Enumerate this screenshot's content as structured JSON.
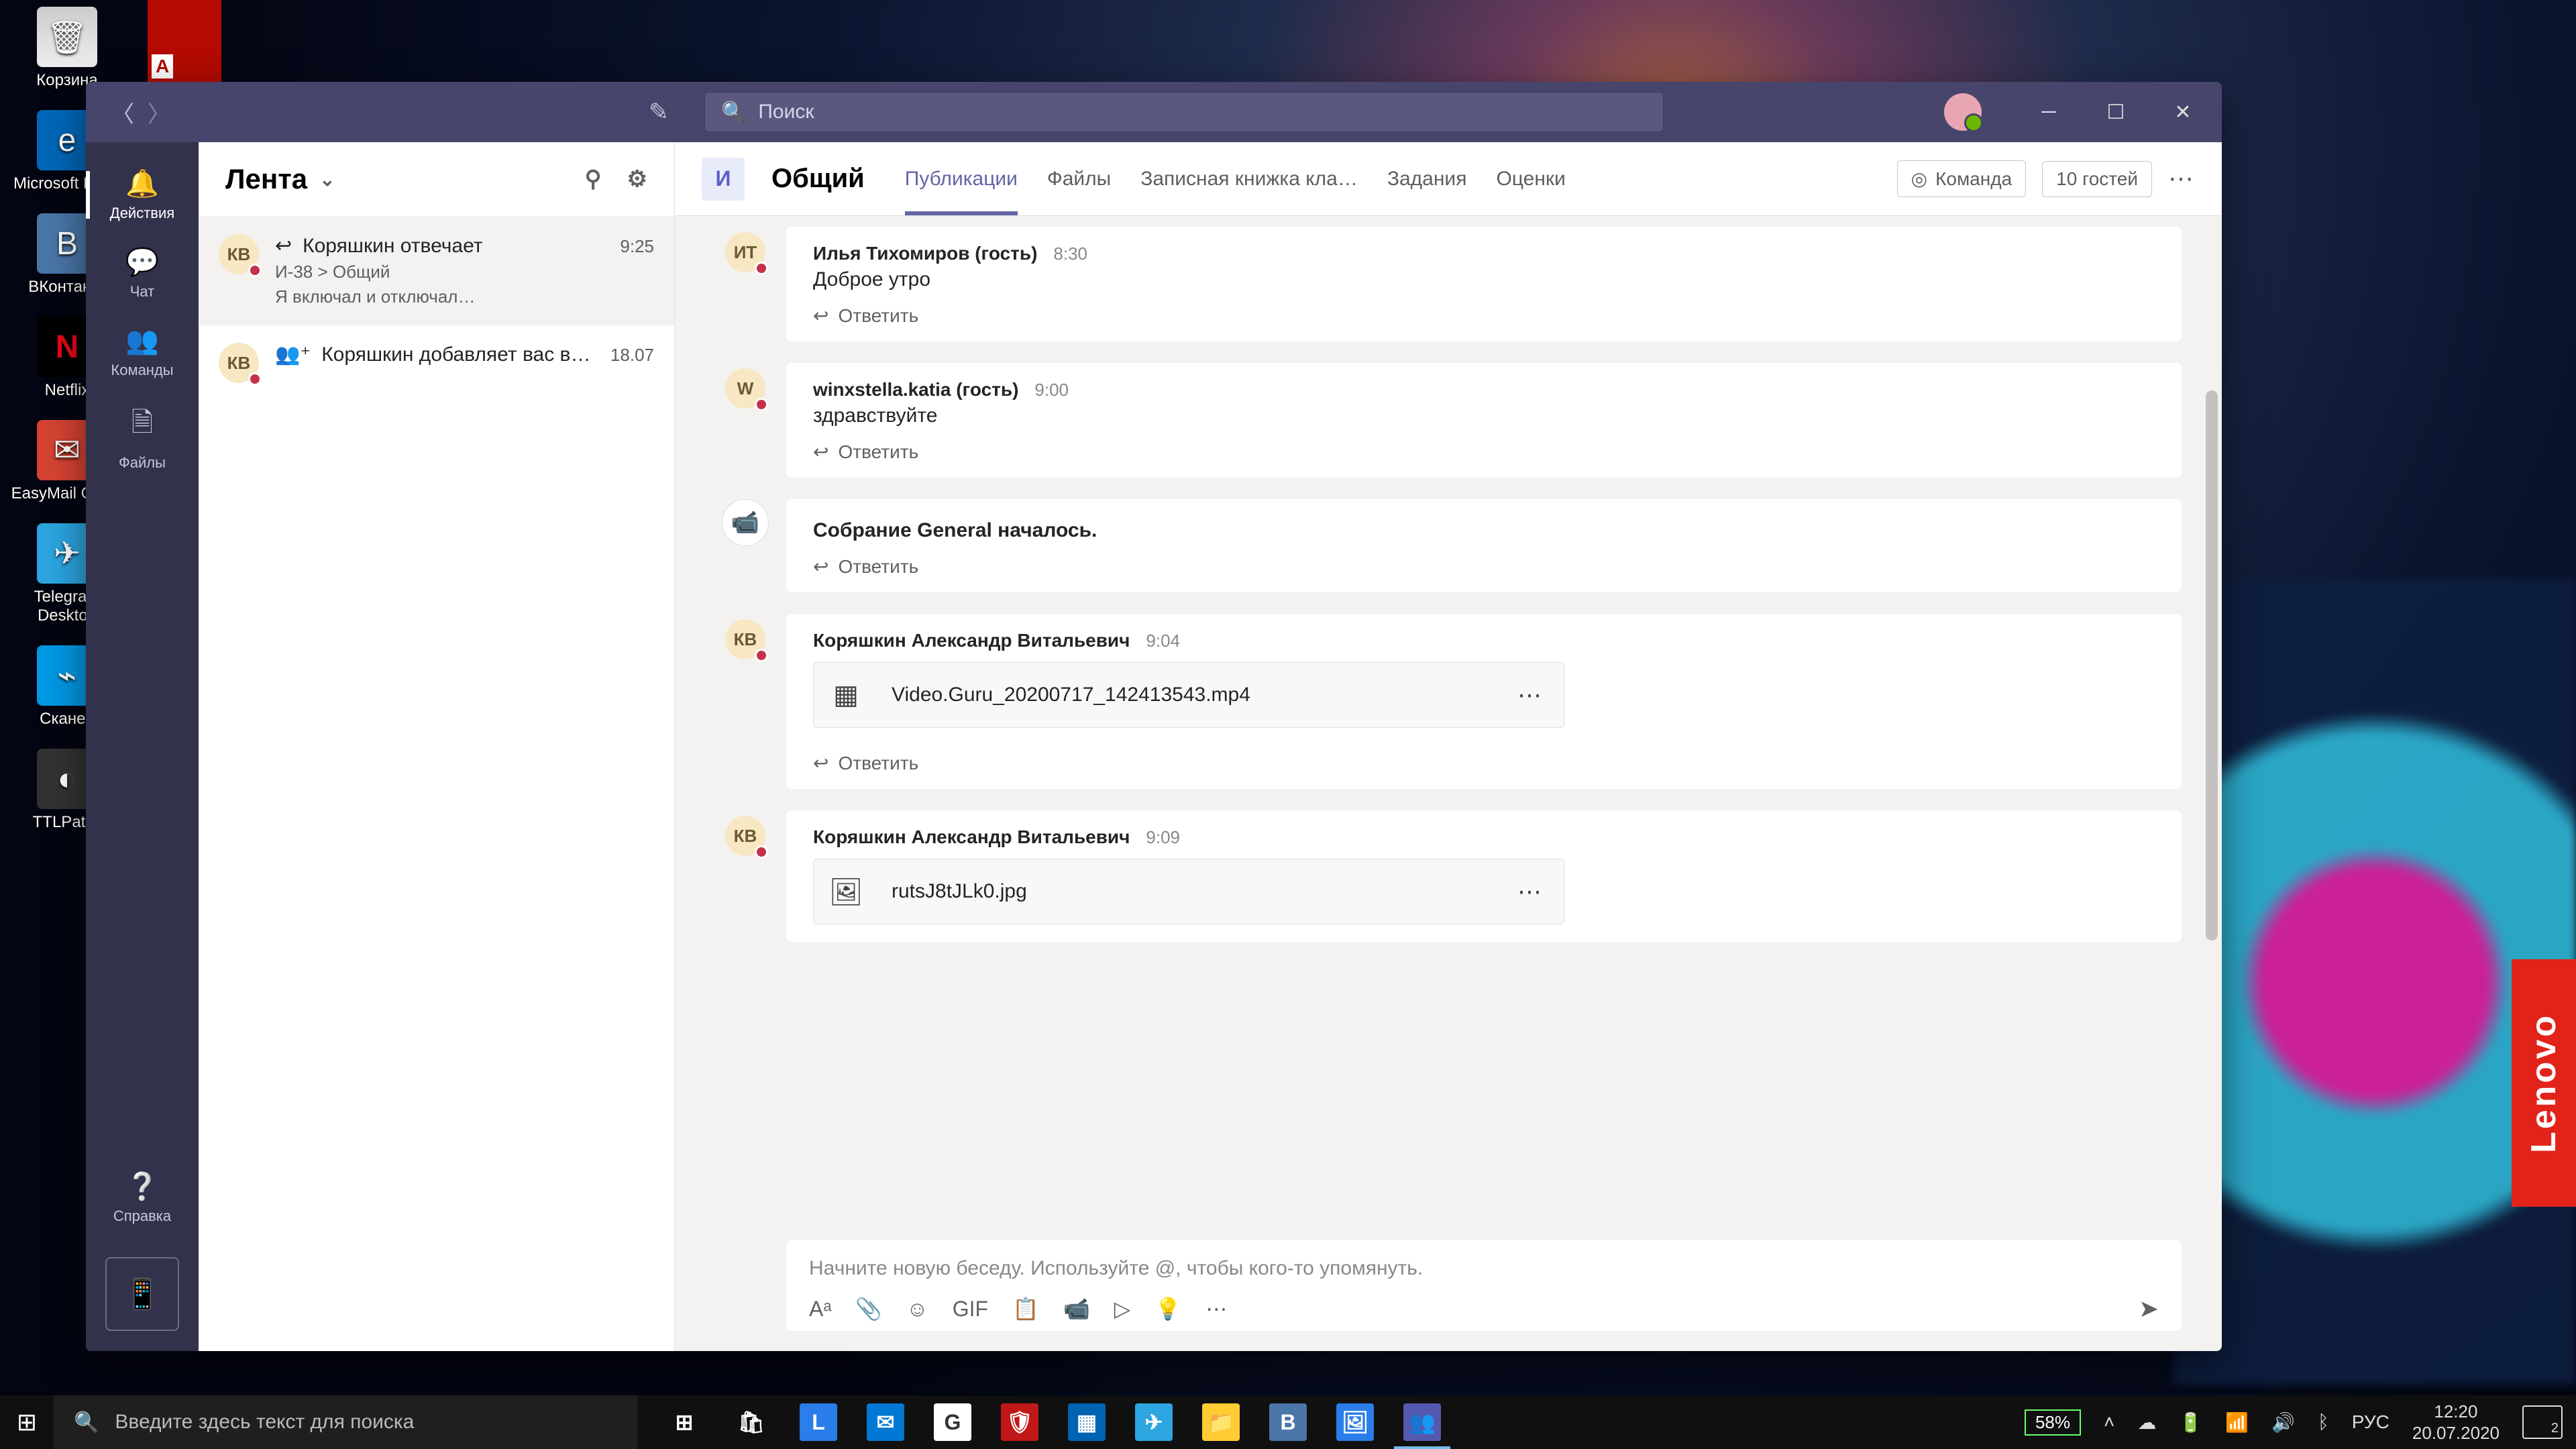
{
  "desktop": {
    "icons": [
      {
        "label": "Корзина",
        "cls": "trash",
        "glyph": "🗑"
      },
      {
        "label": "Microsoft Edge",
        "cls": "edge",
        "glyph": "e"
      },
      {
        "label": "ВКонтакте",
        "cls": "vk",
        "glyph": "B"
      },
      {
        "label": "Netflix",
        "cls": "nflx",
        "glyph": "N"
      },
      {
        "label": "EasyMail Gmail",
        "cls": "gmail",
        "glyph": "✉"
      },
      {
        "label": "Telegram Desktop",
        "cls": "tg",
        "glyph": "✈"
      },
      {
        "label": "Сканер",
        "cls": "scan",
        "glyph": "⌁"
      },
      {
        "label": "TTLPat…",
        "cls": "pat",
        "glyph": "◐"
      }
    ],
    "adobe_glyph": "A",
    "lenovo": "Lenovo"
  },
  "teams": {
    "search_placeholder": "Поиск",
    "rail": [
      {
        "label": "Действия",
        "icon": "🔔",
        "active": true
      },
      {
        "label": "Чат",
        "icon": "💬"
      },
      {
        "label": "Команды",
        "icon": "👥"
      },
      {
        "label": "Файлы",
        "icon": "🗎"
      }
    ],
    "rail_help": "Справка",
    "feed": {
      "title": "Лента",
      "items": [
        {
          "initials": "КВ",
          "pre": "↩",
          "line1": "Коряшкин отвечает",
          "time": "9:25",
          "line2": "И-38 > Общий",
          "line3": "Я включал и отключал…",
          "active": true
        },
        {
          "initials": "КВ",
          "pre": "👥⁺",
          "line1": "Коряшкин добавляет вас в…",
          "time": "18.07"
        }
      ]
    },
    "channel": {
      "team_initial": "И",
      "name": "Общий",
      "tabs": [
        "Публикации",
        "Файлы",
        "Записная книжка кла…",
        "Задания",
        "Оценки"
      ],
      "active_tab": 0,
      "team_btn": "Команда",
      "guests": "10 гостей"
    },
    "messages": [
      {
        "type": "post",
        "initials": "ИТ",
        "author": "Илья Тихомиров (гость)",
        "time": "8:30",
        "text": "Доброе утро",
        "reply": "Ответить"
      },
      {
        "type": "post",
        "initials": "W",
        "av_bg": "#f7e7c3",
        "author": "winxstella.katia (гость)",
        "time": "9:00",
        "text": "здравствуйте",
        "reply": "Ответить"
      },
      {
        "type": "meeting",
        "text": "Собрание General началось.",
        "reply": "Ответить"
      },
      {
        "type": "post",
        "initials": "КВ",
        "author": "Коряшкин Александр Витальевич",
        "time": "9:04",
        "attachment": {
          "icon": "▦",
          "name": "Video.Guru_20200717_142413543.mp4"
        },
        "reply": "Ответить"
      },
      {
        "type": "post",
        "initials": "КВ",
        "author": "Коряшкин Александр Витальевич",
        "time": "9:09",
        "attachment": {
          "icon": "🖼",
          "name": "rutsJ8tJLk0.jpg"
        }
      }
    ],
    "composer": {
      "placeholder": "Начните новую беседу. Используйте @, чтобы кого-то упомянуть.",
      "tools": [
        "Aᵃ",
        "📎",
        "☺",
        "GIF",
        "📋",
        "📹",
        "▷",
        "💡",
        "⋯"
      ],
      "send": "➤"
    }
  },
  "taskbar": {
    "search_placeholder": "Введите здесь текст для поиска",
    "apps": [
      {
        "g": "⊞",
        "name": "task-view"
      },
      {
        "g": "🛍",
        "name": "store"
      },
      {
        "g": "L",
        "name": "lenovo-app",
        "bg": "#2b7de9"
      },
      {
        "g": "✉",
        "name": "mail",
        "bg": "#0078d4"
      },
      {
        "g": "G",
        "name": "chrome",
        "bg": "#fff",
        "fg": "#333"
      },
      {
        "g": "🛡",
        "name": "mcafee",
        "bg": "#c01818"
      },
      {
        "g": "▦",
        "name": "calculator",
        "bg": "#0063b1"
      },
      {
        "g": "✈",
        "name": "telegram",
        "bg": "#2ca5e0"
      },
      {
        "g": "📁",
        "name": "explorer",
        "bg": "#ffcc33",
        "fg": "#333"
      },
      {
        "g": "B",
        "name": "vk",
        "bg": "#4a76a8"
      },
      {
        "g": "🖼",
        "name": "photos",
        "bg": "#2b7de9"
      },
      {
        "g": "👥",
        "name": "teams",
        "bg": "#5558af",
        "active": true
      }
    ],
    "battery": "58%",
    "lang": "РУС",
    "time": "12:20",
    "date": "20.07.2020",
    "notif_count": "2"
  }
}
